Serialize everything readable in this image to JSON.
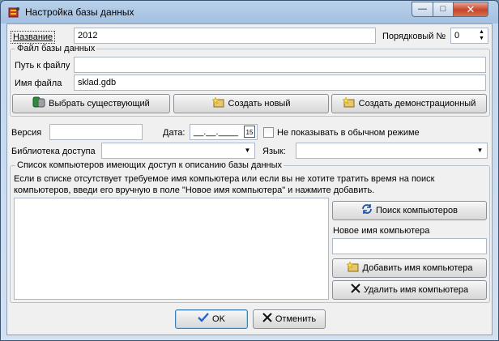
{
  "window": {
    "title": "Настройка базы данных",
    "icon": "database-config-icon",
    "controls": {
      "minimize": "—",
      "maximize": "□",
      "close": "✕"
    }
  },
  "general": {
    "name_label": "Название",
    "name_value": "2012",
    "order_label": "Порядковый №",
    "order_value": "0"
  },
  "file_group": {
    "title": "Файл базы данных",
    "path_label": "Путь к файлу",
    "path_value": "",
    "filename_label": "Имя файла",
    "filename_value": "sklad.gdb",
    "buttons": {
      "choose_existing": "Выбрать существующий",
      "create_new": "Создать новый",
      "create_demo": "Создать демонстрационный"
    }
  },
  "props": {
    "version_label": "Версия",
    "version_value": "",
    "date_label": "Дата:",
    "date_value": "__.__.____",
    "calendar_text": "15",
    "hide_label": "Не показывать в обычном режиме",
    "library_label": "Библиотека доступа",
    "library_value": "",
    "language_label": "Язык:",
    "language_value": ""
  },
  "computers_group": {
    "title": "Список компьютеров имеющих доступ к описанию базы данных",
    "help_line1": "Если в списке отсутствует требуемое имя компьютера или если вы не хотите тратить время на поиск",
    "help_line2": "компьютеров, введи его вручную в поле \"Новое имя компьютера\" и нажмите добавить.",
    "search_button": "Поиск компьютеров",
    "new_name_label": "Новое имя компьютера",
    "new_name_value": "",
    "add_button": "Добавить имя компьютера",
    "delete_button": "Удалить имя компьютера",
    "items": []
  },
  "footer": {
    "ok": "OK",
    "cancel": "Отменить"
  },
  "colors": {
    "accent": "#3c7fb1",
    "ok_check": "#2a62c9",
    "close_button": "#c7452a"
  }
}
